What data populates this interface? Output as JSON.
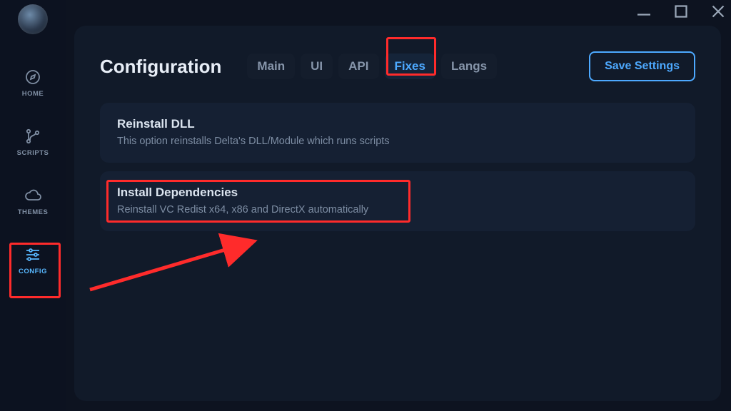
{
  "sidebar": {
    "items": [
      {
        "label": "HOME",
        "icon": "compass-icon"
      },
      {
        "label": "SCRIPTS",
        "icon": "branch-icon"
      },
      {
        "label": "THEMES",
        "icon": "cloud-icon"
      },
      {
        "label": "CONFIG",
        "icon": "sliders-icon"
      }
    ]
  },
  "header": {
    "title": "Configuration",
    "save_label": "Save Settings"
  },
  "tabs": [
    {
      "label": "Main"
    },
    {
      "label": "UI"
    },
    {
      "label": "API"
    },
    {
      "label": "Fixes",
      "active": true
    },
    {
      "label": "Langs"
    }
  ],
  "panels": [
    {
      "title": "Reinstall DLL",
      "desc": "This option reinstalls Delta's DLL/Module which runs scripts"
    },
    {
      "title": "Install Dependencies",
      "desc": "Reinstall VC Redist x64, x86 and DirectX automatically"
    }
  ],
  "colors": {
    "accent": "#4da9ff",
    "annotation": "#ff2b2b"
  }
}
